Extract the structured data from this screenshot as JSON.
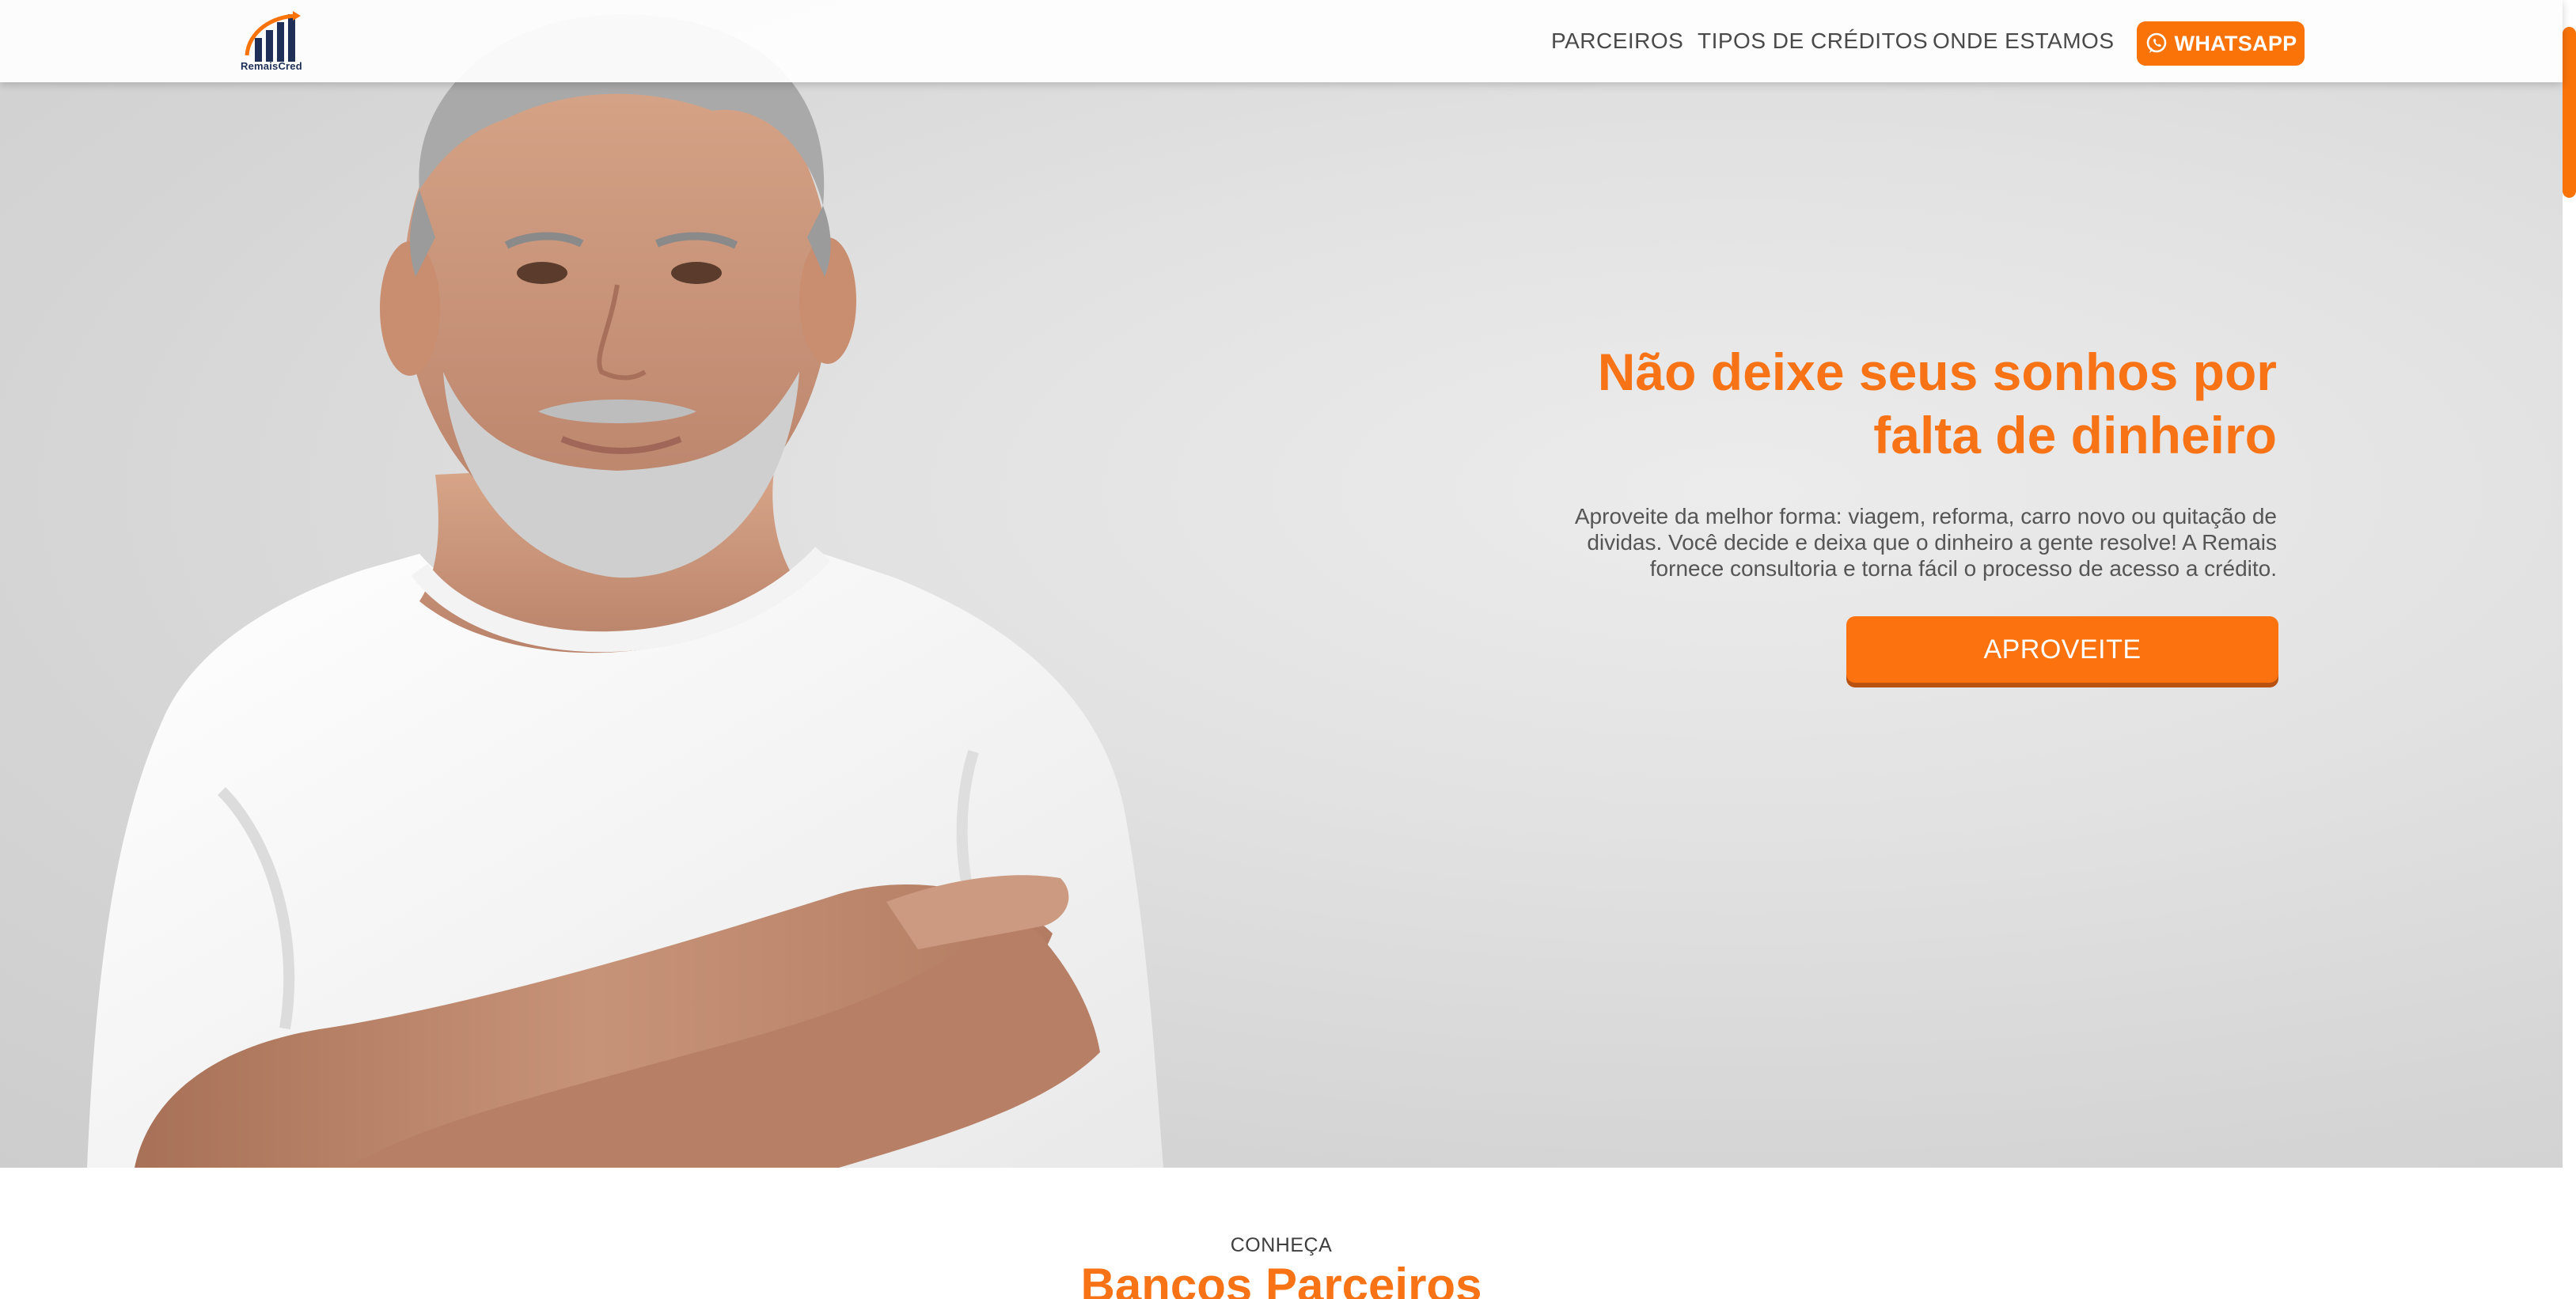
{
  "brand": {
    "name": "RemaisCred",
    "accent_color": "#f97309",
    "logo_color": "#1f2f57"
  },
  "nav": {
    "items": [
      {
        "label": "PARCEIROS"
      },
      {
        "label": "TIPOS DE CRÉDITOS"
      },
      {
        "label": "ONDE ESTAMOS"
      }
    ],
    "whatsapp": {
      "label": "WHATSAPP",
      "icon": "whatsapp-icon"
    }
  },
  "hero": {
    "headline_lines": [
      "Não deixe seus sonhos por",
      "falta de dinheiro"
    ],
    "subtext_lines": [
      "Aproveite da melhor forma: viagem, reforma, carro novo ou quitação de",
      "dividas. Você decide e deixa que o dinheiro a gente resolve! A Remais",
      "fornece consultoria e torna fácil o processo de acesso a crédito."
    ],
    "cta_label": "APROVEITE"
  },
  "partners": {
    "kicker": "CONHEÇA",
    "title": "Bancos Parceiros"
  }
}
